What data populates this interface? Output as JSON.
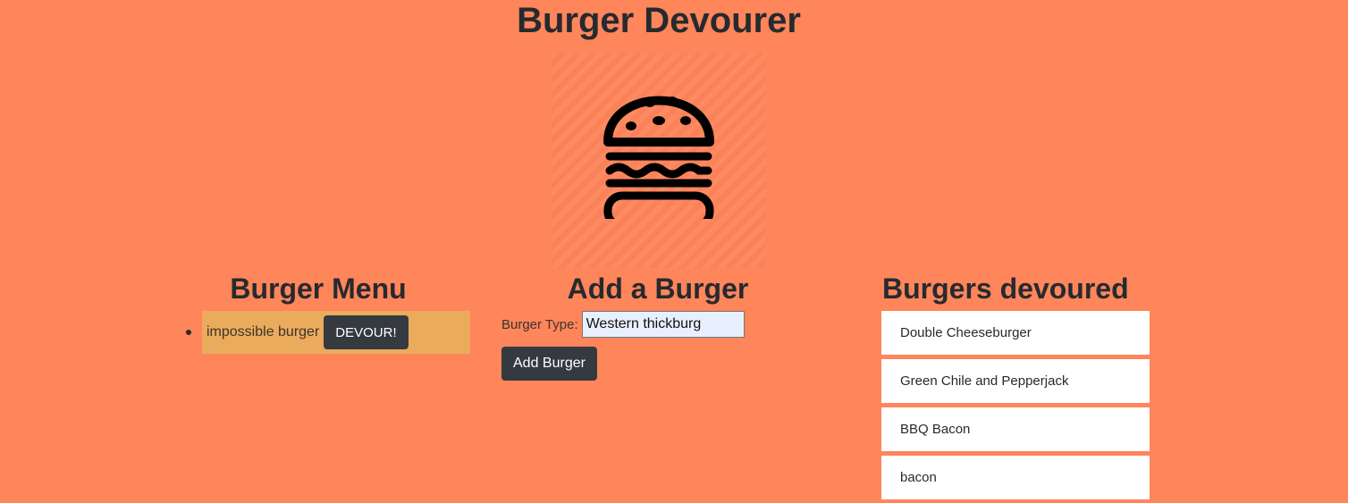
{
  "header": {
    "title": "Burger Devourer"
  },
  "logo": {
    "icon": "burger-icon"
  },
  "menu": {
    "title": "Burger Menu",
    "items": [
      {
        "name": "impossible burger",
        "button_label": "DEVOUR!"
      }
    ]
  },
  "add": {
    "title": "Add a Burger",
    "field_label": "Burger Type:",
    "field_value": "Western thickburg",
    "button_label": "Add Burger"
  },
  "devoured": {
    "title": "Burgers devoured",
    "items": [
      "Double Cheeseburger",
      "Green Chile and Pepperjack",
      "BBQ Bacon",
      "bacon"
    ]
  },
  "colors": {
    "background": "#ff855b",
    "menu_item_bg": "#ebab5c",
    "button": "#343a40"
  }
}
